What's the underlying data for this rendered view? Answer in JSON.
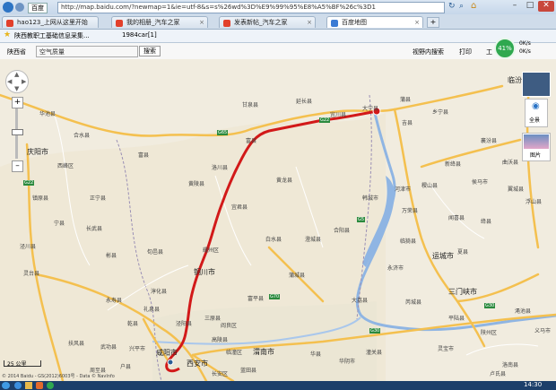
{
  "browser": {
    "url": "http://map.baidu.com/?newmap=1&ie=utf-8&s=s%26wd%3D%E9%99%95%E8%A5%BF%26c%3D1",
    "search_label": "百度",
    "tabs": [
      {
        "label": "hao123_上网从这里开始"
      },
      {
        "label": "我的相册_汽车之家"
      },
      {
        "label": "发表新帖_汽车之家"
      },
      {
        "label": "百度地图"
      }
    ],
    "bookmarks": [
      "陕西教职工基础信息采集...",
      "1984car[1]"
    ]
  },
  "map_toolbar": {
    "location": "陕西省",
    "air_quality": "空气质量",
    "search_button": "搜索",
    "view_search": "视野内搜索",
    "print": "打印",
    "tools": "工",
    "speed_percent": "41%",
    "speed_up": "0K/s",
    "speed_down": "0K/s"
  },
  "map": {
    "cities": [
      "临汾市",
      "庆阳市",
      "铜川市",
      "运城市",
      "渭南市",
      "三门峡市",
      "咸阳市",
      "西安市"
    ],
    "counties": [
      "宜川县",
      "黄龙县",
      "宜君县",
      "韩城市",
      "白水县",
      "澄城县",
      "合阳县",
      "大荔县",
      "蒲城县",
      "富平县",
      "耀州区",
      "乾县",
      "礼泉县",
      "泾阳县",
      "三原县",
      "华县",
      "华阴市",
      "潼关县",
      "长武县",
      "彬县",
      "永寿县",
      "淳化县",
      "旬邑县",
      "黄陵县",
      "洛川县",
      "富县",
      "延长县",
      "甘泉县",
      "吉县",
      "乡宁县",
      "河津市",
      "稷山县",
      "万荣县",
      "临猗县",
      "永济市",
      "芮城县",
      "平陆县",
      "夏县",
      "闻喜县",
      "绛县",
      "侯马市",
      "新绛县",
      "襄汾县",
      "曲沃县",
      "翼城县",
      "浮山县",
      "蒲县",
      "大宁县",
      "宁县",
      "正宁县",
      "合水县",
      "镇原县",
      "泾川县",
      "灵台县",
      "华池县",
      "西峰区",
      "富县",
      "洛南县",
      "蓝田县",
      "长安区",
      "户县",
      "周至县",
      "兴平市",
      "武功县",
      "扶风县",
      "高陵县",
      "临潼区",
      "阎良区",
      "陕州区",
      "渑池县",
      "灵宝市",
      "卢氏县",
      "义马市"
    ],
    "roads": [
      "G22",
      "G22",
      "G65",
      "G5",
      "G30",
      "G70",
      "G30"
    ],
    "side_labels": {
      "pano": "全景",
      "photo": "图片"
    },
    "scale_label": "25 公里",
    "copyright": "© 2014 Baidu - GS(2012)6003号 - Data © NavInfo"
  },
  "statusbar": {
    "time": "14:30"
  },
  "colors": {
    "route": "#d21919",
    "river": "#8fb5e3",
    "highway": "#f4c04f",
    "accent": "#2fa84f"
  }
}
